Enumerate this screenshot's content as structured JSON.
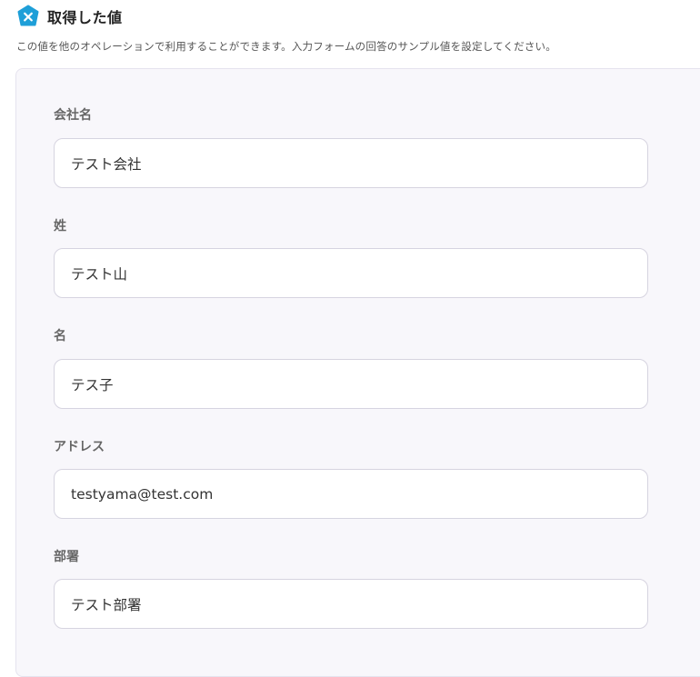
{
  "header": {
    "icon": "variable-x-hexagon-icon",
    "icon_color": "#1e9fd8",
    "title": "取得した値"
  },
  "description": "この値を他のオペレーションで利用することができます。入力フォームの回答のサンプル値を設定してください。",
  "fields": [
    {
      "label": "会社名",
      "value": "テスト会社"
    },
    {
      "label": "姓",
      "value": "テスト山"
    },
    {
      "label": "名",
      "value": "テス子"
    },
    {
      "label": "アドレス",
      "value": "testyama@test.com"
    },
    {
      "label": "部署",
      "value": "テスト部署"
    }
  ]
}
